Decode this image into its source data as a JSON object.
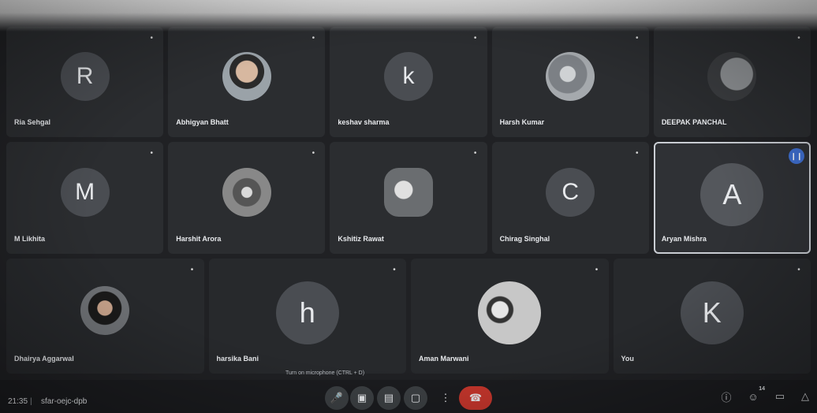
{
  "participants_row1": [
    {
      "name": "Ria Sehgal",
      "initial": "R",
      "avatar_color": "#4a4d52",
      "kind": "letter"
    },
    {
      "name": "Abhigyan Bhatt",
      "initial": "",
      "avatar_color": "#7b7f86",
      "kind": "photo"
    },
    {
      "name": "keshav sharma",
      "initial": "k",
      "avatar_color": "#4a4d52",
      "kind": "letter"
    },
    {
      "name": "Harsh Kumar",
      "initial": "",
      "avatar_color": "#8a8e94",
      "kind": "photo"
    },
    {
      "name": "DEEPAK PANCHAL",
      "initial": "",
      "avatar_color": "#6d7075",
      "kind": "photo"
    }
  ],
  "participants_row2": [
    {
      "name": "M Likhita",
      "initial": "M",
      "avatar_color": "#4a4d52",
      "kind": "letter"
    },
    {
      "name": "Harshit Arora",
      "initial": "",
      "avatar_color": "#6a6d73",
      "kind": "photo"
    },
    {
      "name": "Kshitiz Rawat",
      "initial": "",
      "avatar_color": "#5d6065",
      "kind": "photo"
    },
    {
      "name": "Chirag Singhal",
      "initial": "C",
      "avatar_color": "#4a4d52",
      "kind": "letter"
    },
    {
      "name": "Aryan Mishra",
      "initial": "A",
      "avatar_color": "#54575c",
      "kind": "letter",
      "active": true
    }
  ],
  "participants_row3": [
    {
      "name": "Dhairya Aggarwal",
      "initial": "",
      "avatar_color": "#6e7176",
      "kind": "photo"
    },
    {
      "name": "harsika Bani",
      "initial": "h",
      "avatar_color": "#4a4d52",
      "kind": "letter"
    },
    {
      "name": "Aman Marwani",
      "initial": "",
      "avatar_color": "#8c9095",
      "kind": "photo"
    },
    {
      "name": "You",
      "initial": "K",
      "avatar_color": "#4a4d52",
      "kind": "letter"
    }
  ],
  "mic_icon": "mic-off-icon",
  "hint_text": "Turn on microphone (CTRL + D)",
  "bottom": {
    "time": "21:35",
    "separator": "|",
    "meeting_code": "sfar-oejc-dpb",
    "controls": [
      "mic-icon",
      "camera-icon",
      "captions-icon",
      "present-icon",
      "more-icon",
      "leave-call-icon"
    ],
    "participant_count": "14"
  }
}
